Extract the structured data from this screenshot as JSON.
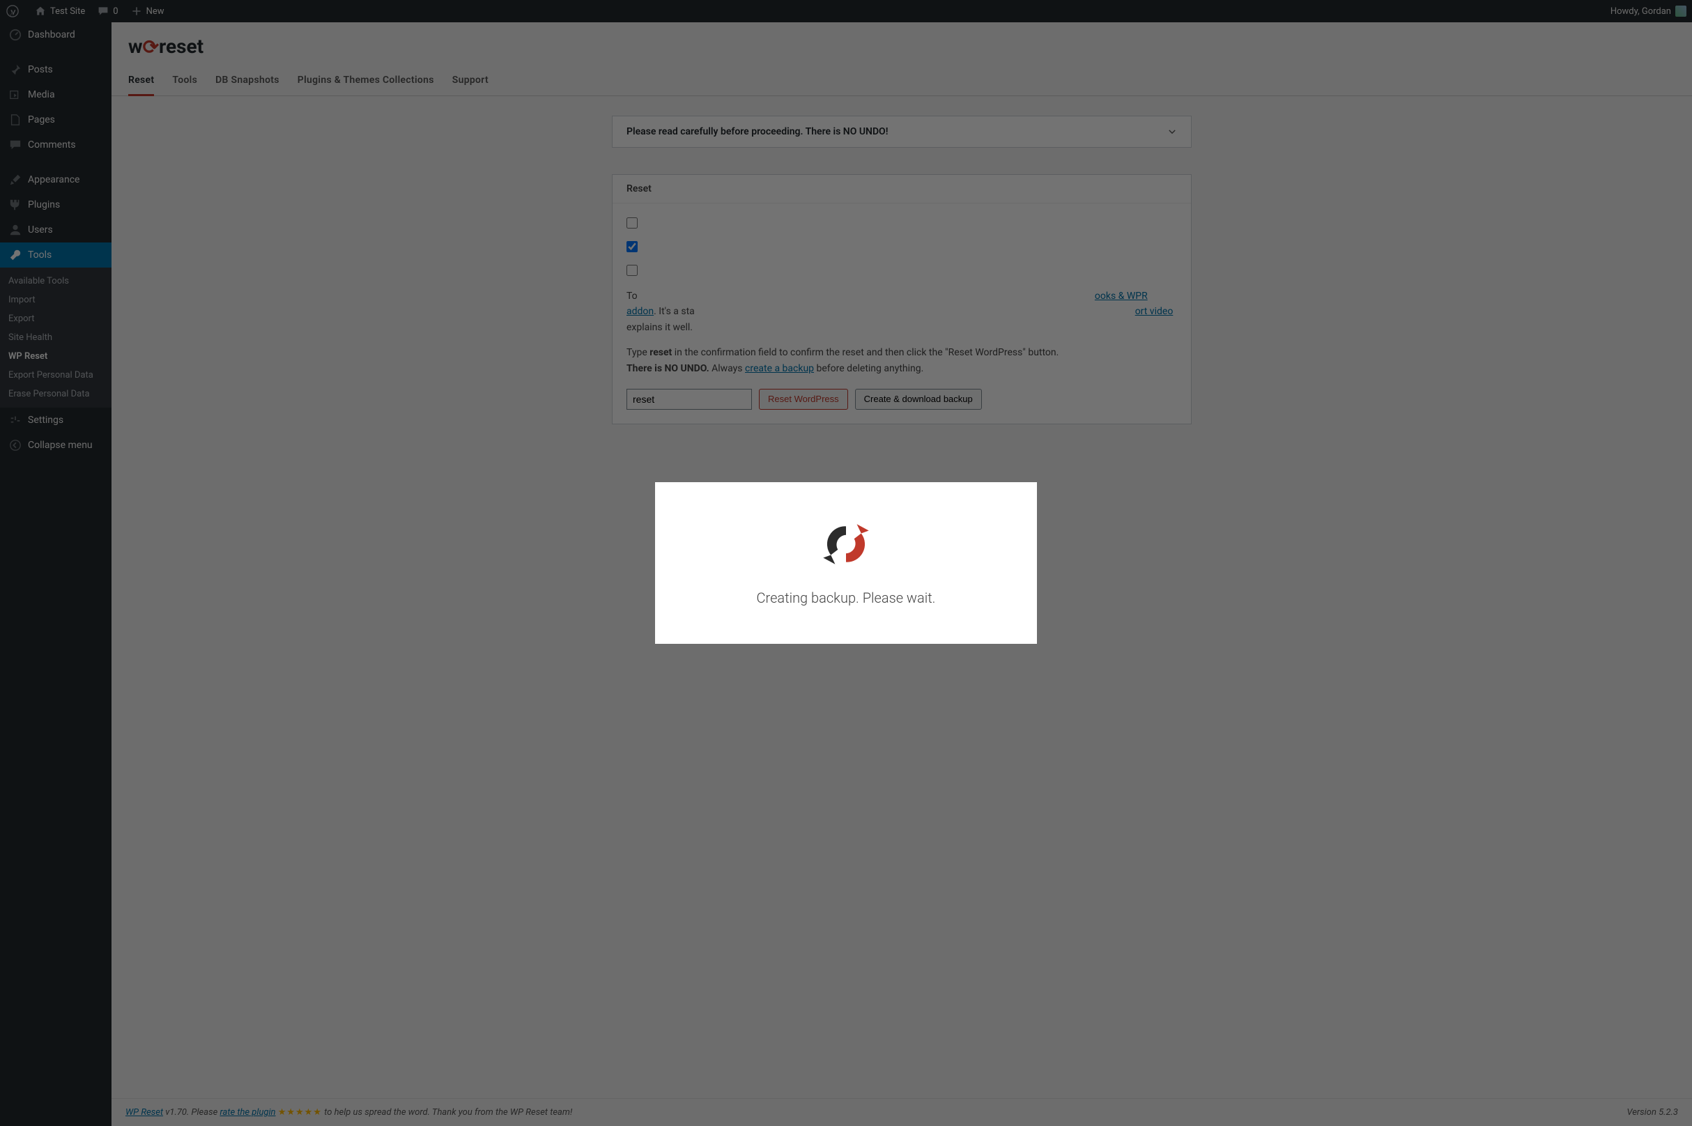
{
  "adminbar": {
    "site_name": "Test Site",
    "comments_count": "0",
    "new_label": "New",
    "howdy": "Howdy, Gordan"
  },
  "sidebar": {
    "items": [
      {
        "label": "Dashboard",
        "icon": "dashboard"
      },
      {
        "label": "Posts",
        "icon": "pin"
      },
      {
        "label": "Media",
        "icon": "media"
      },
      {
        "label": "Pages",
        "icon": "page"
      },
      {
        "label": "Comments",
        "icon": "comment"
      },
      {
        "label": "Appearance",
        "icon": "brush"
      },
      {
        "label": "Plugins",
        "icon": "plug"
      },
      {
        "label": "Users",
        "icon": "user"
      },
      {
        "label": "Tools",
        "icon": "wrench",
        "current": true
      },
      {
        "label": "Settings",
        "icon": "settings"
      },
      {
        "label": "Collapse menu",
        "icon": "collapse"
      }
    ],
    "tools_submenu": [
      "Available Tools",
      "Import",
      "Export",
      "Site Health",
      "WP Reset",
      "Export Personal Data",
      "Erase Personal Data"
    ],
    "tools_submenu_current": "WP Reset"
  },
  "page": {
    "logo_text_1": "w",
    "logo_text_2": "p",
    "logo_text_3": "reset",
    "tabs": [
      "Reset",
      "Tools",
      "DB Snapshots",
      "Plugins & Themes Collections",
      "Support"
    ],
    "active_tab": "Reset",
    "warning": "Please read carefully before proceeding. There is NO UNDO!",
    "panel_title": "Reset",
    "checkbox_rows": [
      {
        "checked": false,
        "label_visible": ""
      },
      {
        "checked": true,
        "label_visible": ""
      },
      {
        "checked": false,
        "label_visible": ""
      }
    ],
    "desc_prefix": "To ",
    "desc_link1": "ooks & WPR addon",
    "desc_after1": ". It's a sta",
    "desc_link2": "ort video",
    "desc_after2": " explains it well.",
    "confirm_line_1a": "Type ",
    "confirm_line_1b": "reset",
    "confirm_line_1c": " in the confirmation field to confirm the reset and then click the \"Reset WordPress\" button.",
    "confirm_line_2a": "There is NO UNDO.",
    "confirm_line_2b": " Always ",
    "confirm_line_link": "create a backup",
    "confirm_line_2c": " before deleting anything.",
    "input_value": "reset",
    "btn_reset": "Reset WordPress",
    "btn_backup": "Create & download backup"
  },
  "footer": {
    "left_1": "WP Reset",
    "left_2": " v1.70. Please ",
    "left_link": "rate the plugin",
    "left_stars": "★★★★★",
    "left_3": " to help us spread the word. Thank you from the WP Reset team!",
    "version": "Version 5.2.3"
  },
  "modal": {
    "text": "Creating backup. Please wait."
  }
}
